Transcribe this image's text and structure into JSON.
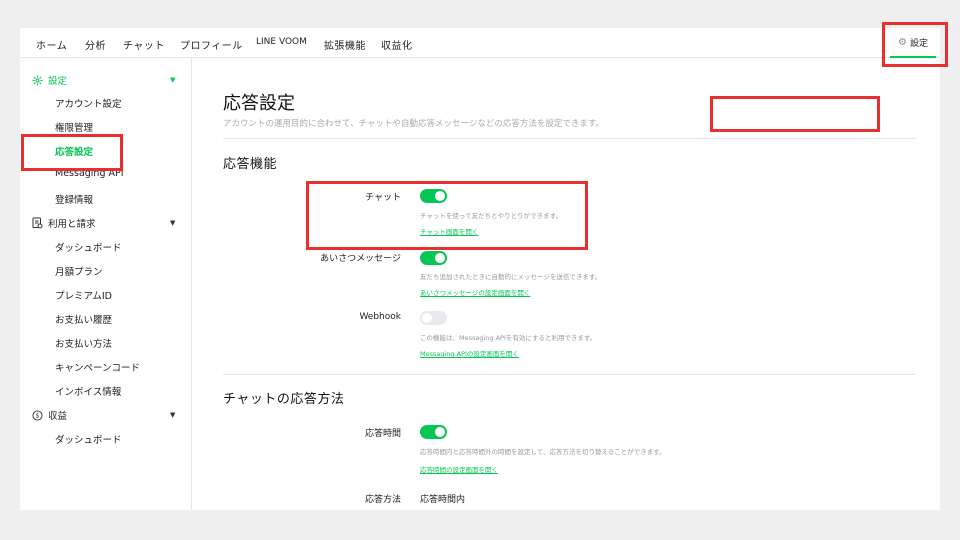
{
  "topnav": {
    "items": [
      "ホーム",
      "分析",
      "チャット",
      "プロフィール",
      "LINE VOOM",
      "拡張機能",
      "収益化"
    ],
    "settings_label": "設定"
  },
  "sidebar": {
    "sections": [
      {
        "label": "設定",
        "icon": "gear-icon",
        "active": true,
        "items": [
          "アカウント設定",
          "権限管理",
          "応答設定",
          "Messaging API",
          "登録情報"
        ]
      },
      {
        "label": "利用と請求",
        "icon": "billing-icon",
        "active": false,
        "items": [
          "ダッシュボード",
          "月額プラン",
          "プレミアムID",
          "お支払い履歴",
          "お支払い方法",
          "キャンペーンコード",
          "インボイス情報"
        ]
      },
      {
        "label": "収益",
        "icon": "dollar-circle-icon",
        "active": false,
        "items": [
          "ダッシュボード"
        ]
      }
    ],
    "active_item": "応答設定"
  },
  "main": {
    "title": "応答設定",
    "description": "アカウントの運用目的に合わせて、チャットや自動応答メッセージなどの応答方法を設定できます。",
    "features_title": "応答機能",
    "features": [
      {
        "label": "チャット",
        "enabled": true,
        "desc": "チャットを使って友だちとやりとりができます。",
        "link": "チャット画面を開く"
      },
      {
        "label": "あいさつメッセージ",
        "enabled": true,
        "desc": "友だち追加されたときに自動的にメッセージを送信できます。",
        "link": "あいさつメッセージの設定画面を開く"
      },
      {
        "label": "Webhook",
        "enabled": false,
        "desc": "この機能は、Messaging APIを有効にすると利用できます。",
        "link": "Messaging APIの設定画面を開く"
      }
    ],
    "method_title": "チャットの応答方法",
    "response_time": {
      "label": "応答時間",
      "enabled": true,
      "desc": "応答時間内と応答時間外の時間を設定して、応答方法を切り替えることができます。",
      "link": "応答時間の設定画面を開く"
    },
    "response_method": {
      "label": "応答方法",
      "value": "応答時間内"
    }
  },
  "colors": {
    "accent": "#06c755",
    "highlight": "#e8302f",
    "toggle_off": "#e8e8ee"
  }
}
